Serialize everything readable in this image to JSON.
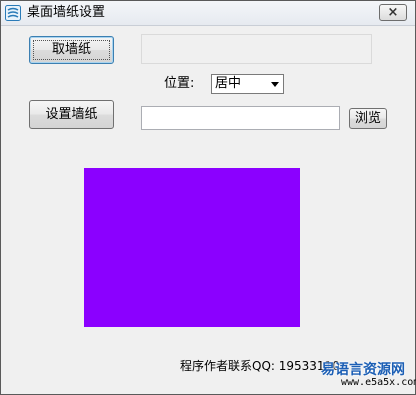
{
  "window": {
    "title": "桌面墙纸设置",
    "close_glyph": "×",
    "app_icon": "app-logo-icon"
  },
  "buttons": {
    "get_wallpaper": "取墙纸",
    "set_wallpaper": "设置墙纸",
    "browse": "浏览"
  },
  "position": {
    "label": "位置:",
    "selected": "居中"
  },
  "path_input": {
    "value": ""
  },
  "preview": {
    "color": "#8b00ff"
  },
  "footer": {
    "contact": "程序作者联系QQ: 19533110"
  },
  "watermark": {
    "logo_text": "易语言资源网",
    "url": "www.e5a5x.com"
  }
}
